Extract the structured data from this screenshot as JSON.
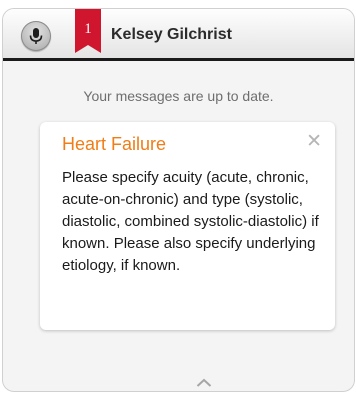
{
  "header": {
    "mic_icon": "microphone-icon",
    "notification_count": "1",
    "patient_name": "Kelsey Gilchrist",
    "badge_color": "#d0162e"
  },
  "status": {
    "text": "Your messages are up to date."
  },
  "card": {
    "title": "Heart Failure",
    "close_icon": "close-icon",
    "body": "Please specify acuity (acute, chronic, acute-on-chronic) and type (systolic, diastolic, combined systolic-diastolic) if known. Please also specify underlying etiology, if known.",
    "title_color": "#f07d17"
  },
  "footer": {
    "expand_icon": "chevron-up-icon"
  }
}
